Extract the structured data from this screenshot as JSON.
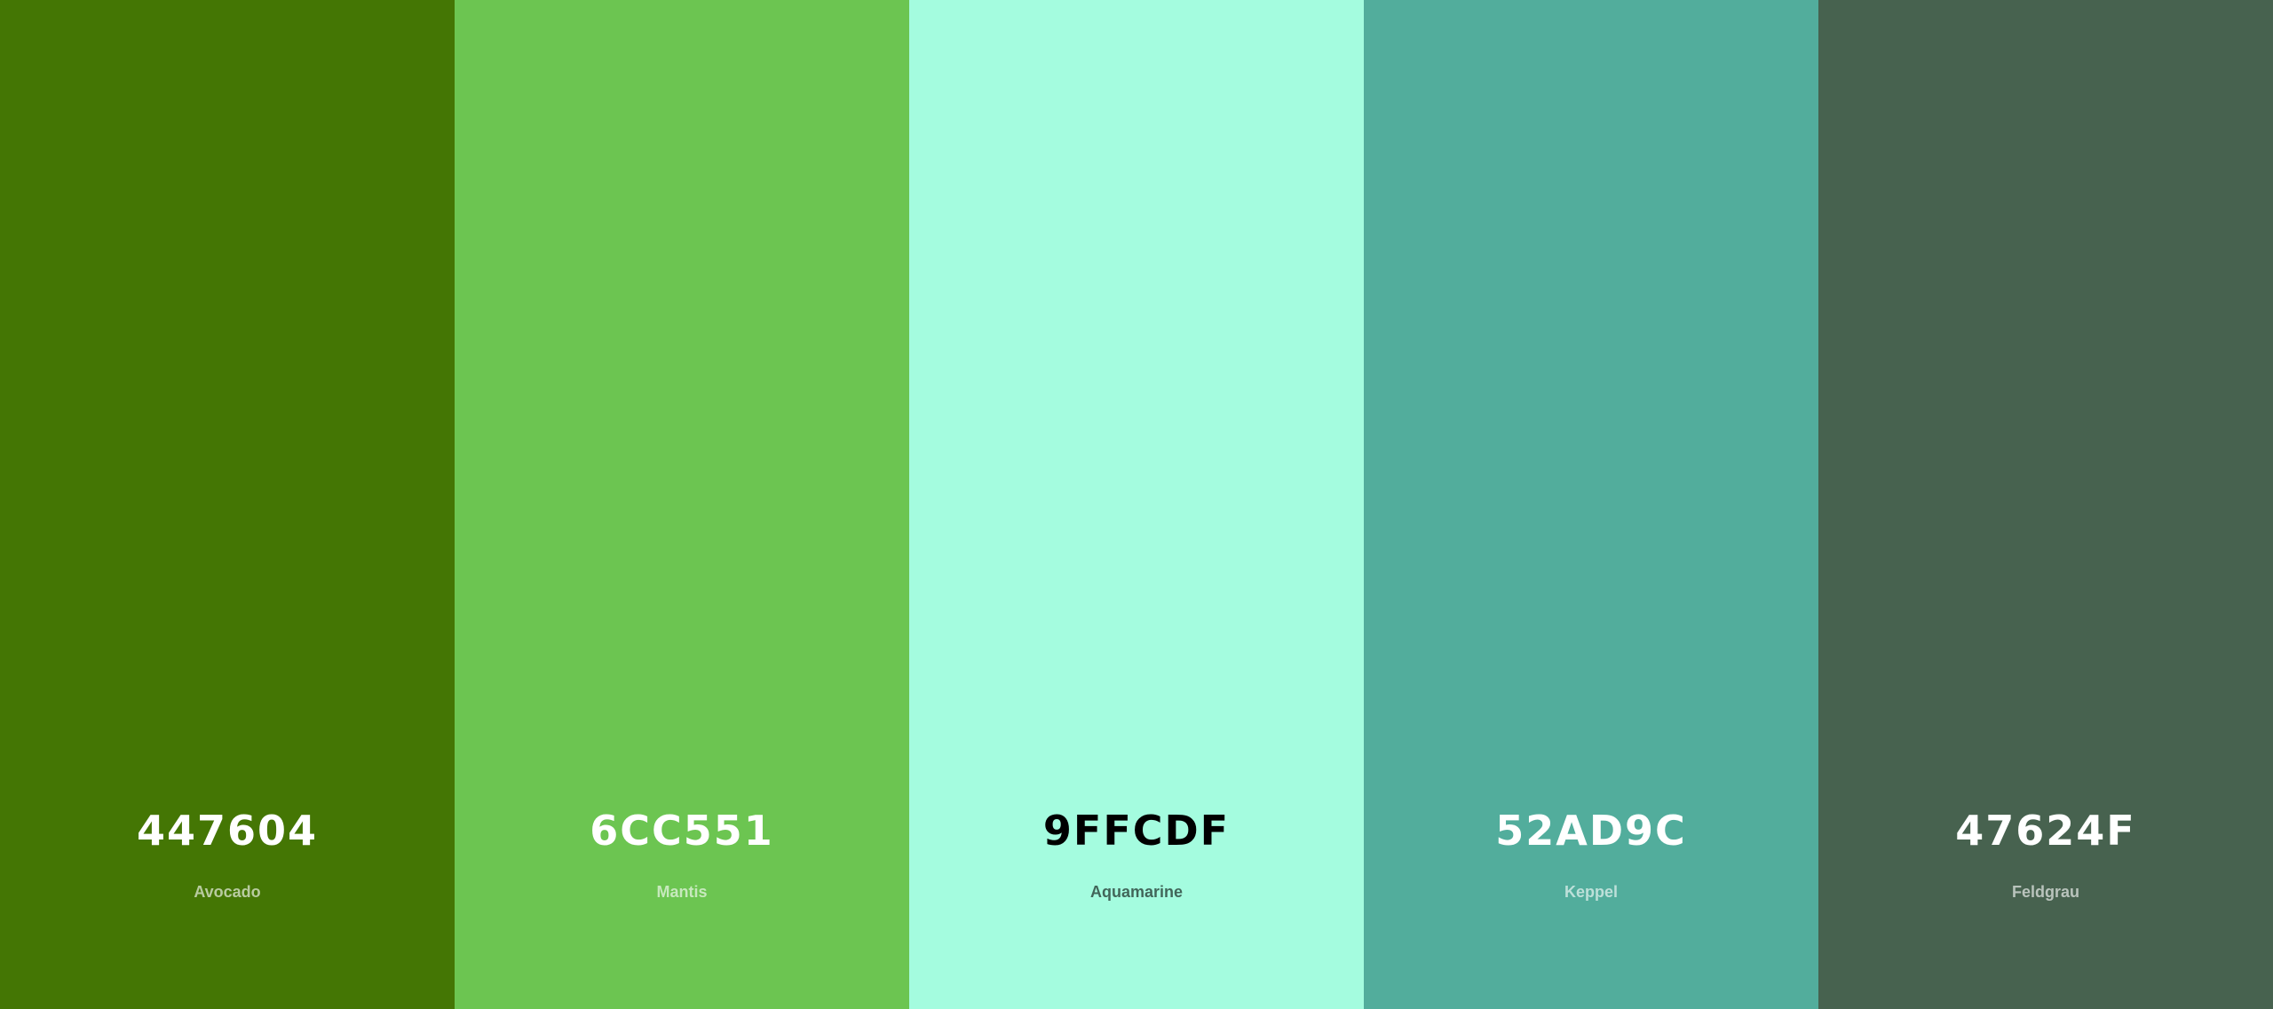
{
  "palette": {
    "colors": [
      {
        "hex": "447604",
        "name": "Avocado",
        "color": "#447604",
        "text_tone": "light"
      },
      {
        "hex": "6CC551",
        "name": "Mantis",
        "color": "#6CC551",
        "text_tone": "light"
      },
      {
        "hex": "9FFCDF",
        "name": "Aquamarine",
        "color": "#A4FCDF",
        "text_tone": "dark"
      },
      {
        "hex": "52AD9C",
        "name": "Keppel",
        "color": "#52AD9C",
        "text_tone": "light"
      },
      {
        "hex": "47624F",
        "name": "Feldgrau",
        "color": "#47624F",
        "text_tone": "light"
      }
    ]
  }
}
